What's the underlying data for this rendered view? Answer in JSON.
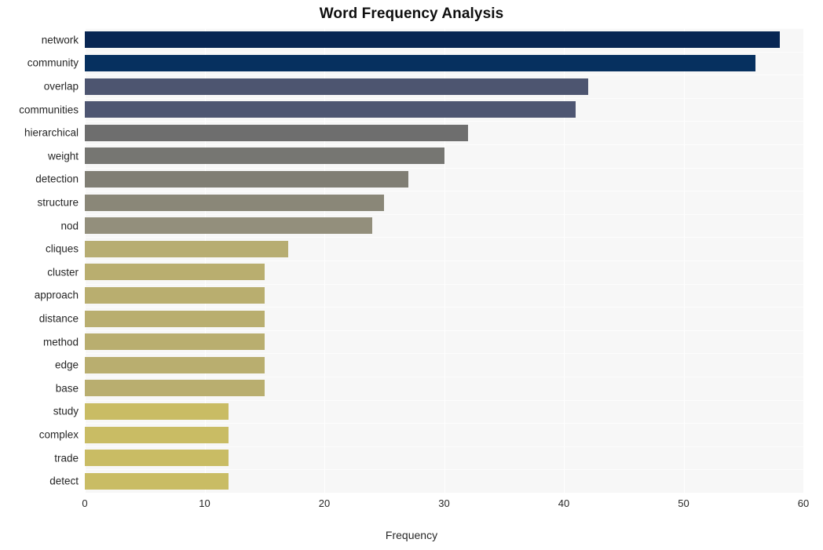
{
  "chart_data": {
    "type": "bar",
    "orientation": "horizontal",
    "title": "Word Frequency Analysis",
    "xlabel": "Frequency",
    "ylabel": "",
    "xlim": [
      0,
      60
    ],
    "xticks": [
      0,
      10,
      20,
      30,
      40,
      50,
      60
    ],
    "xtick_labels": [
      "0",
      "10",
      "20",
      "30",
      "40",
      "50",
      "60"
    ],
    "grid": true,
    "legend": "none",
    "categories": [
      "network",
      "community",
      "overlap",
      "communities",
      "hierarchical",
      "weight",
      "detection",
      "structure",
      "nod",
      "cliques",
      "cluster",
      "approach",
      "distance",
      "method",
      "edge",
      "base",
      "study",
      "complex",
      "trade",
      "detect"
    ],
    "values": [
      58,
      56,
      42,
      41,
      32,
      30,
      27,
      25,
      24,
      17,
      15,
      15,
      15,
      15,
      15,
      15,
      12,
      12,
      12,
      12
    ],
    "bar_colors": [
      "#082653",
      "#06305f",
      "#4d5570",
      "#4e5672",
      "#6e6e6e",
      "#767672",
      "#807e74",
      "#8a8778",
      "#938f7c",
      "#b7ad72",
      "#b9ae6f",
      "#b9ae6f",
      "#b9ae6f",
      "#b9ae6f",
      "#b9ae6f",
      "#b9ae6f",
      "#c9bc64",
      "#c9bc64",
      "#c9bc64",
      "#c9bc64"
    ],
    "plot_background": "#f7f7f7",
    "gridline_color": "#ffffff",
    "figure_background": "#ffffff"
  }
}
